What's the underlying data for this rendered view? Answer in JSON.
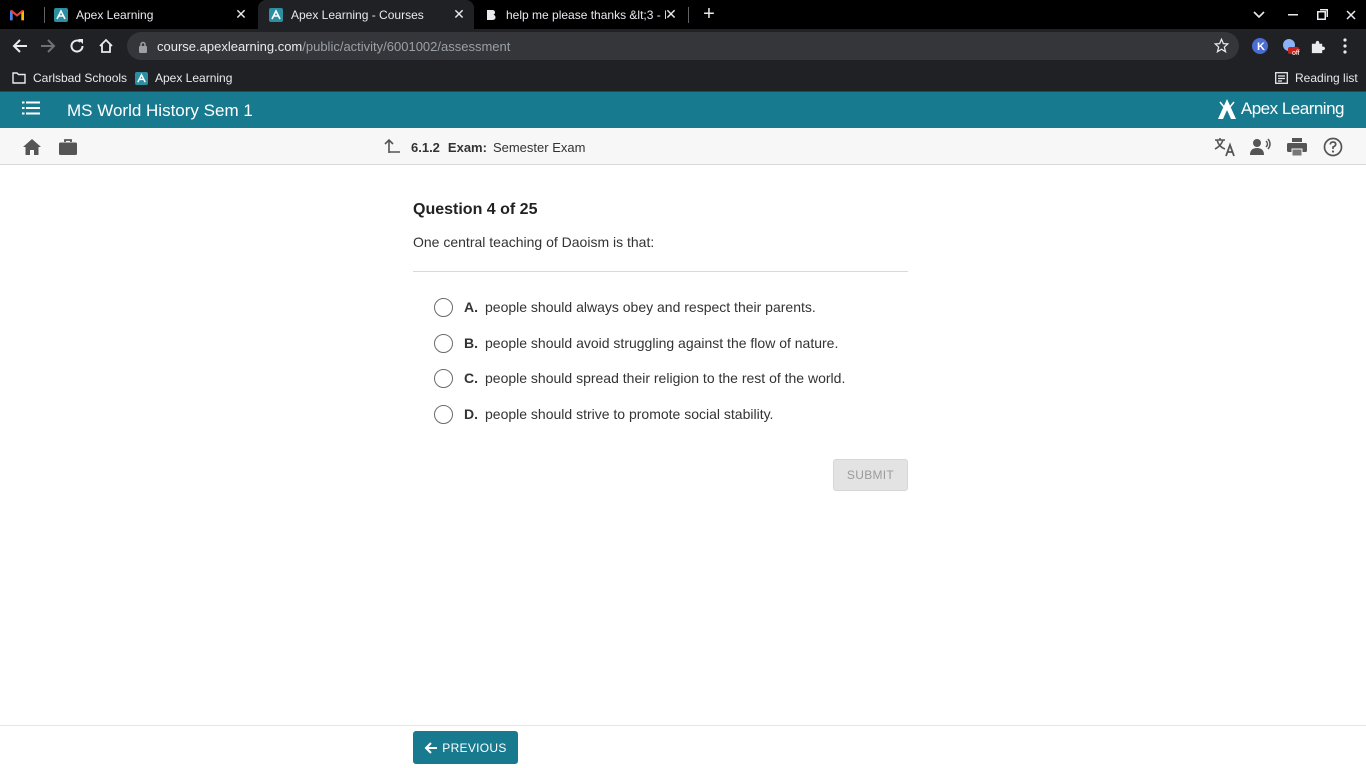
{
  "browser": {
    "tabs": [
      {
        "title": "Apex Learning",
        "favicon": "apex-icon"
      },
      {
        "title": "Apex Learning - Courses",
        "favicon": "apex-icon",
        "active": true
      },
      {
        "title": "help me please thanks &lt;3 - Bra",
        "favicon": "brainly-icon"
      }
    ],
    "url_host": "course.apexlearning.com",
    "url_path": "/public/activity/6001002/assessment",
    "extension_badge": "off",
    "bookmarks": [
      {
        "label": "Carlsbad Schools",
        "icon": "folder-icon"
      },
      {
        "label": "Apex Learning",
        "icon": "apex-icon"
      }
    ],
    "reading_list": "Reading list"
  },
  "app": {
    "course_title": "MS World History Sem 1",
    "brand": "Apex Learning",
    "accent_color": "#177a8f"
  },
  "activity": {
    "number": "6.1.2",
    "kind": "Exam:",
    "name": "Semester Exam"
  },
  "question": {
    "header": "Question 4 of 25",
    "prompt": "One central teaching of Daoism is that:",
    "choices": [
      {
        "letter": "A.",
        "text": "people should always obey and respect their parents."
      },
      {
        "letter": "B.",
        "text": "people should avoid struggling against the flow of nature."
      },
      {
        "letter": "C.",
        "text": "people should spread their religion to the rest of the world."
      },
      {
        "letter": "D.",
        "text": "people should strive to promote social stability."
      }
    ],
    "submit_label": "SUBMIT"
  },
  "footer": {
    "previous_label": "PREVIOUS"
  }
}
